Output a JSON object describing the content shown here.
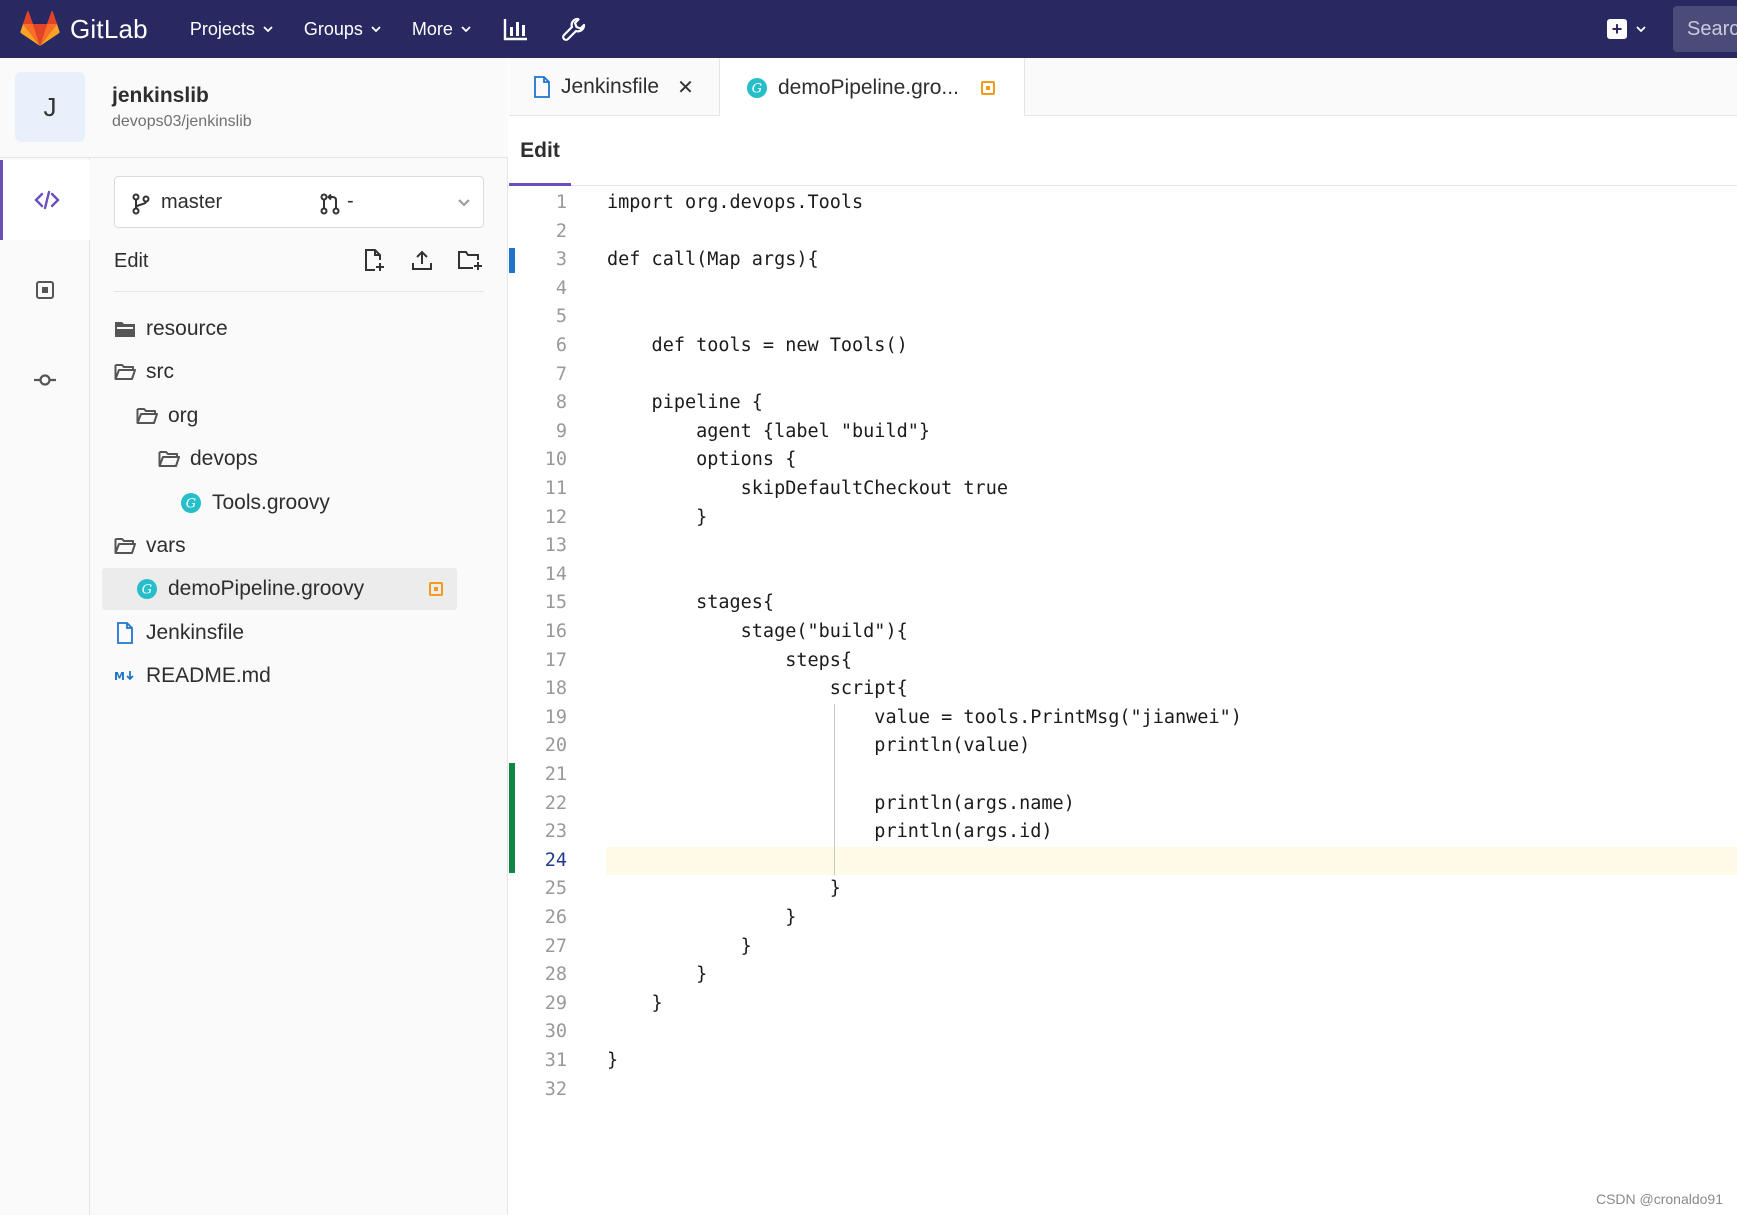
{
  "navbar": {
    "brand": "GitLab",
    "items": [
      {
        "label": "Projects"
      },
      {
        "label": "Groups"
      },
      {
        "label": "More"
      }
    ],
    "search_placeholder": "Searc"
  },
  "project": {
    "avatar_letter": "J",
    "name": "jenkinslib",
    "path": "devops03/jenkinslib"
  },
  "sidebar": {
    "branch": "master",
    "merge_request": "-",
    "edit_label": "Edit",
    "tree": [
      {
        "label": "resource",
        "type": "folder-closed",
        "depth": 0
      },
      {
        "label": "src",
        "type": "folder-open",
        "depth": 0
      },
      {
        "label": "org",
        "type": "folder-open",
        "depth": 1
      },
      {
        "label": "devops",
        "type": "folder-open",
        "depth": 2
      },
      {
        "label": "Tools.groovy",
        "type": "groovy",
        "depth": 3
      },
      {
        "label": "vars",
        "type": "folder-open",
        "depth": 0
      },
      {
        "label": "demoPipeline.groovy",
        "type": "groovy",
        "depth": 1,
        "selected": true,
        "changed": true
      },
      {
        "label": "Jenkinsfile",
        "type": "file",
        "depth": 0
      },
      {
        "label": "README.md",
        "type": "markdown",
        "depth": 0
      }
    ]
  },
  "tabs": [
    {
      "label": "Jenkinsfile",
      "icon": "file-icon",
      "closable": true
    },
    {
      "label": "demoPipeline.gro...",
      "icon": "groovy-icon",
      "changed": true,
      "active": true
    }
  ],
  "editor": {
    "mode_label": "Edit",
    "current_line": 24,
    "lines": [
      "import org.devops.Tools",
      "",
      "def call(Map args){",
      "",
      "",
      "    def tools = new Tools()",
      "",
      "    pipeline {",
      "        agent {label \"build\"}",
      "        options {",
      "            skipDefaultCheckout true",
      "        }",
      "",
      "",
      "        stages{",
      "            stage(\"build\"){",
      "                steps{",
      "                    script{",
      "                        value = tools.PrintMsg(\"jianwei\")",
      "                        println(value)",
      "",
      "                        println(args.name)",
      "                        println(args.id)",
      "",
      "                    }",
      "                }",
      "            }",
      "        }",
      "    }",
      "",
      "}",
      ""
    ]
  },
  "watermark": "CSDN @cronaldo91",
  "colors": {
    "navbar": "#292961",
    "accent": "#6b4fbb",
    "changed": "#f29a1a",
    "modified_line": "#1f75cb",
    "added_line": "#108548"
  }
}
